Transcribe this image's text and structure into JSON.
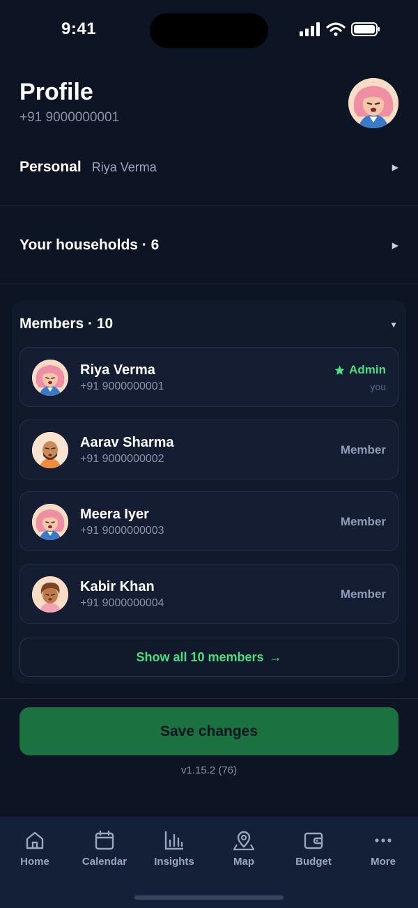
{
  "status": {
    "time": "9:41"
  },
  "profile": {
    "title": "Profile",
    "phone": "+91 9000000001"
  },
  "personal": {
    "label": "Personal",
    "value": "Riya Verma"
  },
  "households": {
    "label": "Your households · 6"
  },
  "members": {
    "header": "Members · 10",
    "items": [
      {
        "name": "Riya Verma",
        "phone": "+91 9000000001",
        "role": "Admin",
        "tag": "you",
        "avatar": "woman-pink-hair"
      },
      {
        "name": "Aarav Sharma",
        "phone": "+91 9000000002",
        "role": "Member",
        "avatar": "man-bald-beard"
      },
      {
        "name": "Meera Iyer",
        "phone": "+91 9000000003",
        "role": "Member",
        "avatar": "woman-pink-hair"
      },
      {
        "name": "Kabir Khan",
        "phone": "+91 9000000004",
        "role": "Member",
        "avatar": "man-curly-hair"
      }
    ],
    "show_all": "Show all 10 members",
    "show_all_arrow": "→"
  },
  "save_label": "Save changes",
  "version": "v1.15.2 (76)",
  "tabs": [
    {
      "label": "Home",
      "icon": "home-icon"
    },
    {
      "label": "Calendar",
      "icon": "calendar-icon"
    },
    {
      "label": "Insights",
      "icon": "insights-icon"
    },
    {
      "label": "Map",
      "icon": "map-pin-icon"
    },
    {
      "label": "Budget",
      "icon": "wallet-icon"
    },
    {
      "label": "More",
      "icon": "more-icon"
    }
  ],
  "colors": {
    "accent": "#4ade80",
    "save_bg": "#1b7140",
    "background": "#0d1524",
    "tab_bar": "#132038"
  }
}
